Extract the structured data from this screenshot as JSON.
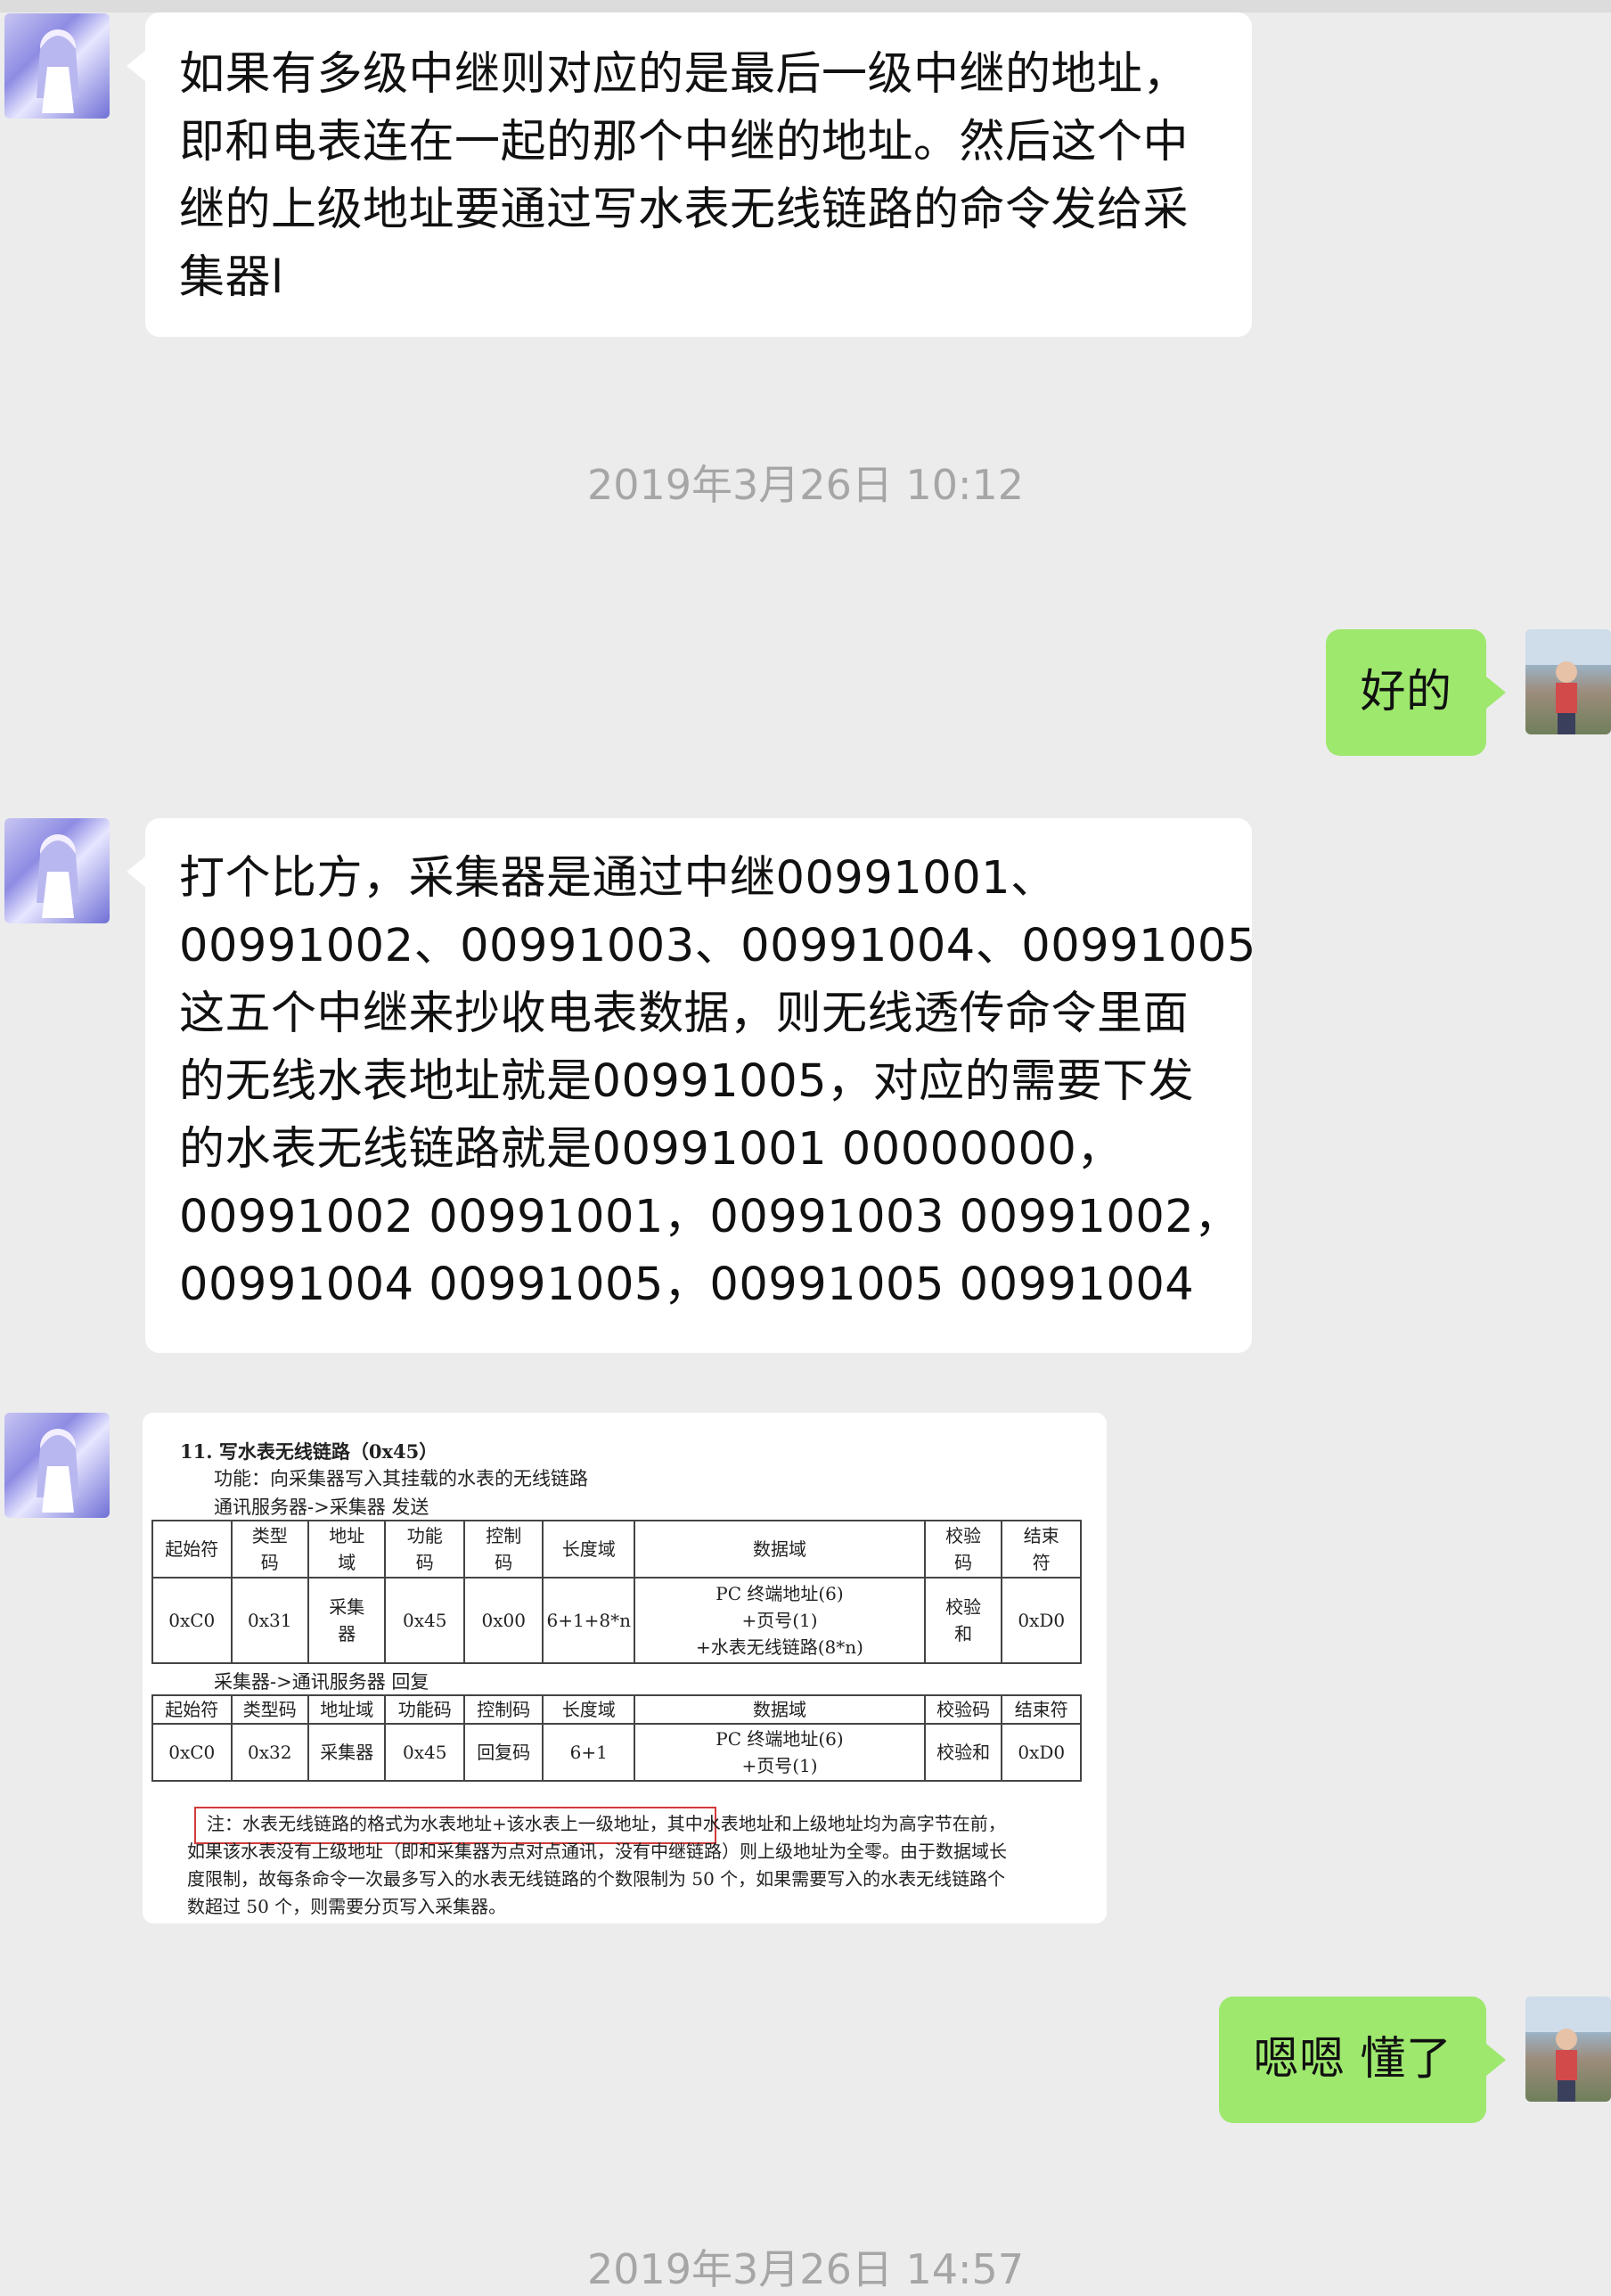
{
  "messages": {
    "m1": {
      "lines": [
        "如果有多级中继则对应的是最后一级中继的地址，",
        "即和电表连在一起的那个中继的地址。然后这个中",
        "继的上级地址要通过写水表无线链路的命令发给采",
        "集器l"
      ]
    },
    "ts1": "2019年3月26日 10:12",
    "m2": {
      "text": "好的"
    },
    "m3": {
      "lines": [
        "打个比方，采集器是通过中继00991001、",
        "00991002、00991003、00991004、00991005",
        "这五个中继来抄收电表数据，则无线透传命令里面",
        "的无线水表地址就是00991005，对应的需要下发",
        "的水表无线链路就是00991001 00000000，",
        "00991002 00991001，00991003 00991002，",
        "00991004 00991005，00991005 00991004"
      ]
    },
    "m5": {
      "text": "嗯嗯 懂了"
    },
    "ts2": "2019年3月26日 14:57"
  },
  "doc": {
    "heading": "11. 写水表无线链路（0x45）",
    "func": "功能：向采集器写入其挂载的水表的无线链路",
    "send_dir": "通讯服务器->采集器  发送",
    "send_headers": [
      "起始符",
      "类型\n码",
      "地址\n域",
      "功能\n码",
      "控制\n码",
      "长度域",
      "数据域",
      "校验\n码",
      "结束\n符"
    ],
    "send_row": [
      "0xC0",
      "0x31",
      "采集\n器",
      "0x45",
      "0x00",
      "6+1+8*n",
      "PC 终端地址(6)\n+页号(1)\n+水表无线链路(8*n)",
      "校验\n和",
      "0xD0"
    ],
    "reply_dir": "采集器->通讯服务器  回复",
    "reply_headers": [
      "起始符",
      "类型码",
      "地址域",
      "功能码",
      "控制码",
      "长度域",
      "数据域",
      "校验码",
      "结束符"
    ],
    "reply_row": [
      "0xC0",
      "0x32",
      "采集器",
      "0x45",
      "回复码",
      "6+1",
      "PC 终端地址(6)\n+页号(1)",
      "校验和",
      "0xD0"
    ],
    "note_lines": [
      "注：水表无线链路的格式为水表地址+该水表上一级地址，其中水表地址和上级地址均为高字节在前，",
      "如果该水表没有上级地址（即和采集器为点对点通讯，没有中继链路）则上级地址为全零。由于数据域长",
      "度限制，故每条命令一次最多写入的水表无线链路的个数限制为 50 个，如果需要写入的水表无线链路个",
      "数超过 50 个，则需要分页写入采集器。"
    ]
  },
  "colors": {
    "bg": "#ececec",
    "incoming": "#ffffff",
    "outgoing": "#9ee86e",
    "timestamp": "#a6a6a6",
    "highlight": "#d23a3a"
  }
}
